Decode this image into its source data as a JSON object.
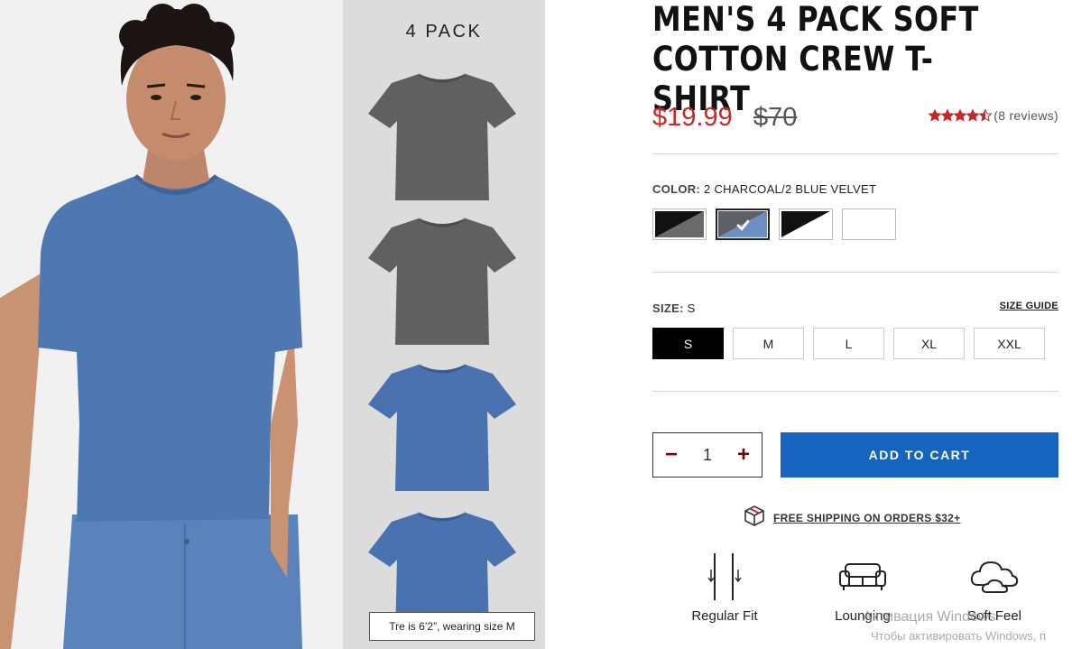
{
  "product": {
    "title": "MEN'S 4 PACK SOFT COTTON CREW T-SHIRT",
    "price": "$19.99",
    "original_price": "$70",
    "rating_stars": 4.5,
    "reviews_text": "(8 reviews)"
  },
  "gallery": {
    "pack_label": "4 PACK",
    "model_note": "Tre is 6’2”, wearing size M",
    "pack_shirts": [
      {
        "color": "#5f6062"
      },
      {
        "color": "#5f6062"
      },
      {
        "color": "#4a72b0"
      },
      {
        "color": "#4a72b0"
      }
    ],
    "model_shirt_color": "#4f78b3"
  },
  "color": {
    "label": "COLOR:",
    "value": "2 CHARCOAL/2 BLUE VELVET",
    "swatches": [
      {
        "name": "black-charcoal",
        "colors": [
          "#111111",
          "#6a6a6a"
        ],
        "selected": false
      },
      {
        "name": "charcoal-blue",
        "colors": [
          "#5d6066",
          "#6b8fc4"
        ],
        "selected": true
      },
      {
        "name": "black-white",
        "colors": [
          "#111111",
          "#ffffff"
        ],
        "selected": false
      },
      {
        "name": "white",
        "colors": [
          "#ffffff",
          "#ffffff"
        ],
        "selected": false
      }
    ]
  },
  "size": {
    "label": "SIZE:",
    "value": "S",
    "guide": "SIZE GUIDE",
    "options": [
      "S",
      "M",
      "L",
      "XL",
      "XXL"
    ],
    "selected": "S"
  },
  "cart": {
    "quantity": "1",
    "minus": "−",
    "plus": "+",
    "add_label": "ADD TO CART"
  },
  "shipping": {
    "text": "FREE SHIPPING ON ORDERS $32+"
  },
  "features": [
    {
      "label": "Regular Fit",
      "icon": "regular-fit-icon"
    },
    {
      "label": "Lounging",
      "icon": "couch-icon"
    },
    {
      "label": "Soft Feel",
      "icon": "cloud-icon"
    }
  ],
  "watermark": {
    "line1": "Активация Windows",
    "line2": "Чтобы активировать Windows, п"
  },
  "colors": {
    "price_red": "#c62828",
    "cta_blue": "#1565c0",
    "star_red": "#c62828",
    "qty_icon": "#6b0a0a"
  }
}
